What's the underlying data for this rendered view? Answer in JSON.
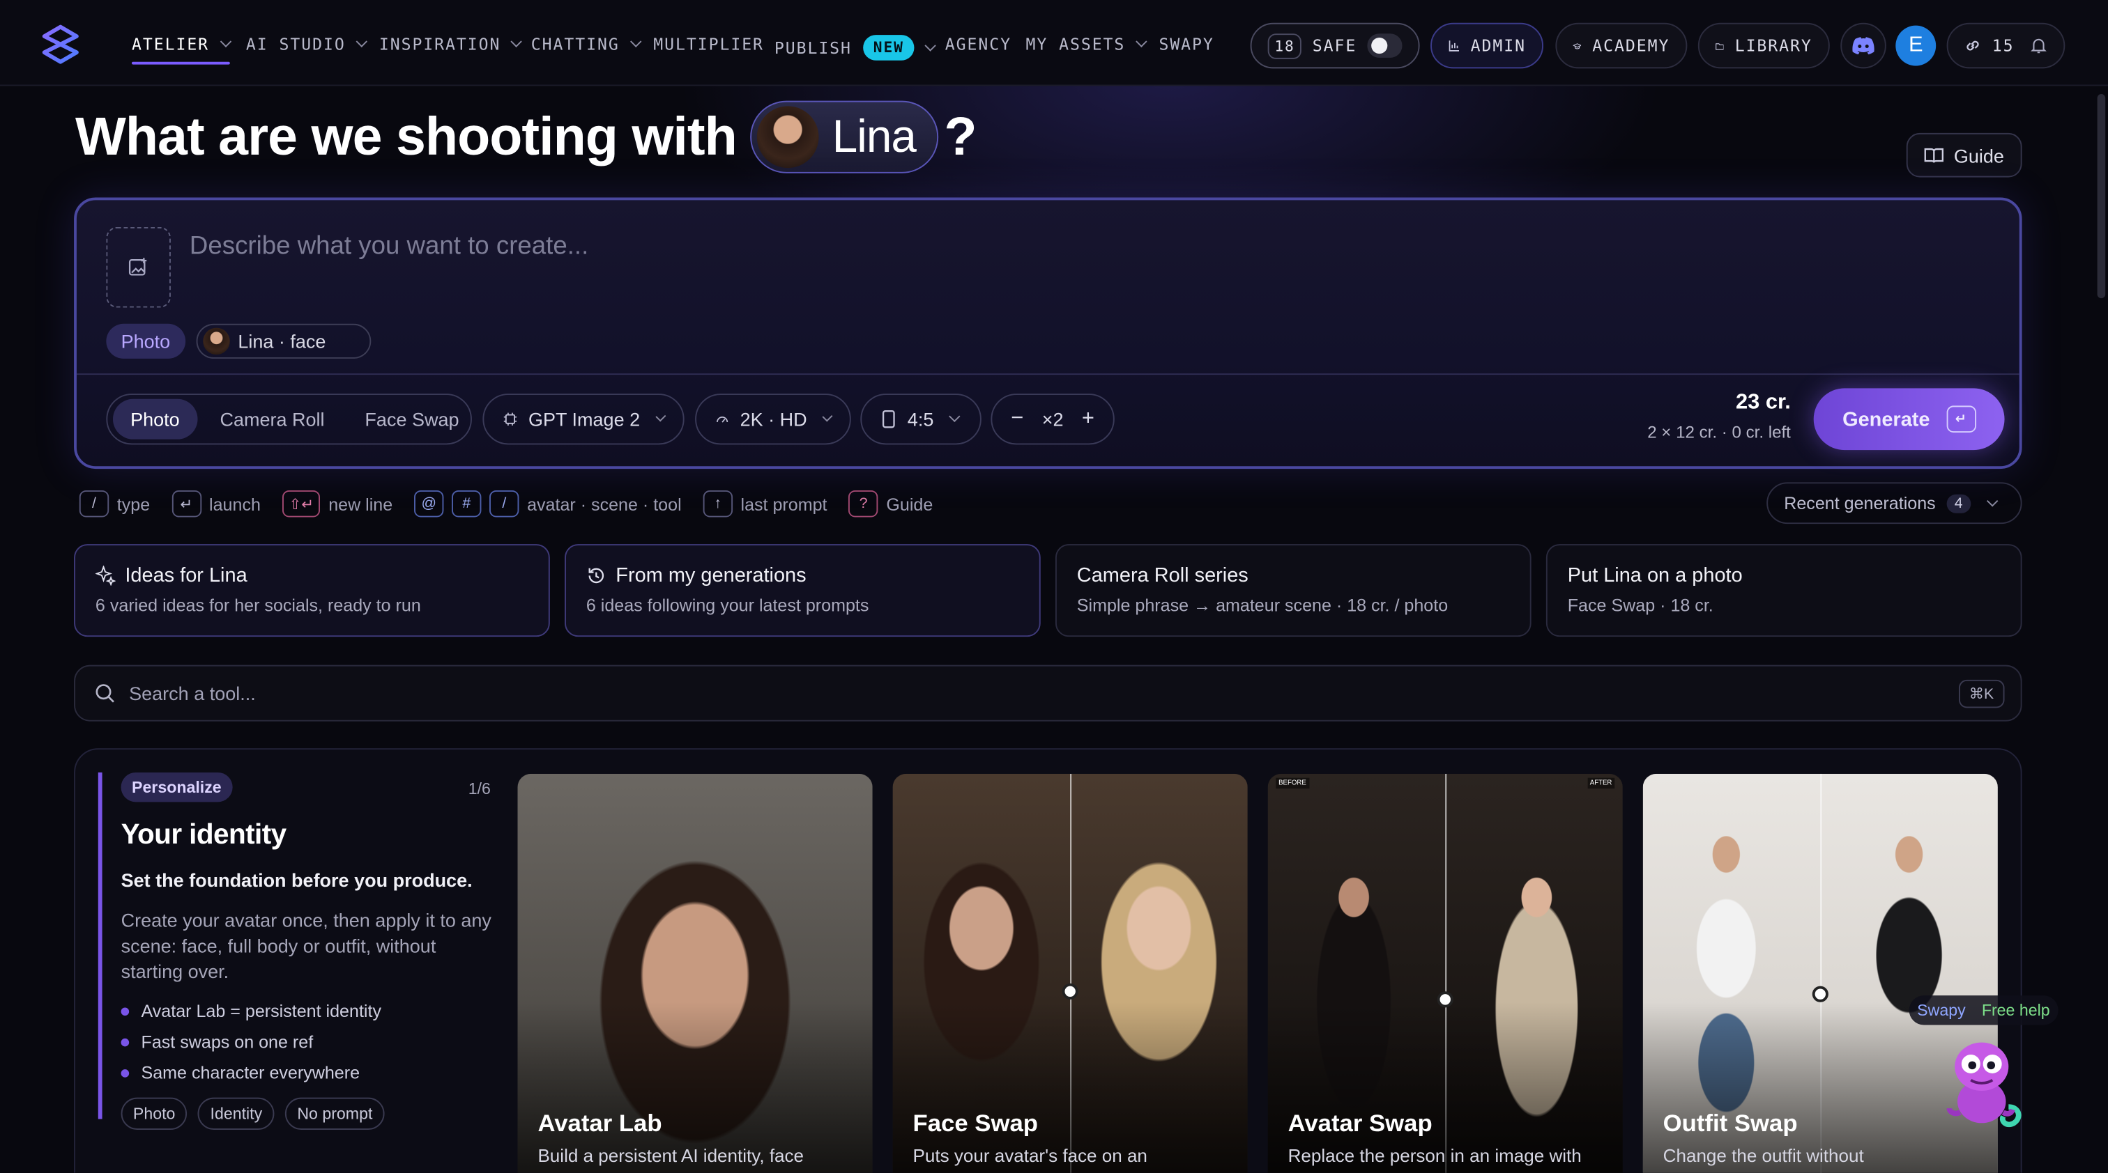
{
  "nav": {
    "items": [
      {
        "label": "ATELIER",
        "dropdown": true,
        "active": true
      },
      {
        "label": "AI STUDIO",
        "dropdown": true
      },
      {
        "label": "INSPIRATION",
        "dropdown": true
      },
      {
        "label": "CHATTING",
        "dropdown": true
      },
      {
        "label": "MULTIPLIER",
        "dropdown": false
      },
      {
        "label": "PUBLISH",
        "dropdown": true,
        "badge": "NEW"
      },
      {
        "label": "AGENCY",
        "dropdown": false
      },
      {
        "label": "MY ASSETS",
        "dropdown": true
      },
      {
        "label": "SWAPY",
        "dropdown": false
      }
    ],
    "safe_count": "18",
    "safe_label": "SAFE",
    "admin_label": "ADMIN",
    "academy_label": "ACADEMY",
    "library_label": "LIBRARY",
    "avatar_initial": "E",
    "credits": "15",
    "accent_color": "#7b5cff"
  },
  "heading": {
    "prefix": "What are we shooting with",
    "avatar_name": "Lina",
    "suffix": "?"
  },
  "guide_label": "Guide",
  "prompt": {
    "placeholder": "Describe what you want to create...",
    "tag_type": "Photo",
    "tag_avatar": "Lina · face",
    "modes": [
      "Photo",
      "Camera Roll",
      "Face Swap"
    ],
    "model": "GPT Image 2",
    "resolution": "2K · HD",
    "ratio": "4:5",
    "quantity": "×2",
    "cost": "23 cr.",
    "cost_detail": "2 × 12 cr. · 0 cr. left",
    "generate_label": "Generate"
  },
  "hints": [
    {
      "keys": [
        "/"
      ],
      "label": "type",
      "style": ""
    },
    {
      "keys": [
        "↵"
      ],
      "label": "launch",
      "style": ""
    },
    {
      "keys": [
        "⇧↵"
      ],
      "label": "new line",
      "style": "pink"
    },
    {
      "keys": [
        "@",
        "#",
        "/"
      ],
      "label": "avatar · scene · tool",
      "style": "blue"
    },
    {
      "keys": [
        "↑"
      ],
      "label": "last prompt",
      "style": ""
    },
    {
      "keys": [
        "?"
      ],
      "label": "Guide",
      "style": "pink"
    }
  ],
  "recent": {
    "label": "Recent generations",
    "count": "4"
  },
  "quick_cards": [
    {
      "title": "Ideas for Lina",
      "subtitle": "6 varied ideas for her socials, ready to run",
      "icon": "sparkles-icon"
    },
    {
      "title": "From my generations",
      "subtitle": "6 ideas following your latest prompts",
      "icon": "history-icon"
    },
    {
      "title": "Camera Roll series",
      "subtitle": "Simple phrase → amateur scene · 18 cr. / photo",
      "icon": ""
    },
    {
      "title": "Put Lina on a photo",
      "subtitle": "Face Swap · 18 cr.",
      "icon": ""
    }
  ],
  "search": {
    "placeholder": "Search a tool...",
    "shortcut": "⌘K"
  },
  "identity": {
    "chip": "Personalize",
    "counter": "1/6",
    "title": "Your identity",
    "lead": "Set the foundation before you produce.",
    "description": "Create your avatar once, then apply it to any scene: face, full body or outfit, without starting over.",
    "bullets": [
      "Avatar Lab = persistent identity",
      "Fast swaps on one ref",
      "Same character everywhere"
    ],
    "tags": [
      "Photo",
      "Identity",
      "No prompt"
    ]
  },
  "tools": [
    {
      "name": "Avatar Lab",
      "description": "Build a persistent AI identity, face",
      "split": false
    },
    {
      "name": "Face Swap",
      "description": "Puts your avatar's face on an",
      "split": true
    },
    {
      "name": "Avatar Swap",
      "description": "Replace the person in an image with",
      "split": true,
      "before_label": "BEFORE",
      "after_label": "AFTER"
    },
    {
      "name": "Outfit Swap",
      "description": "Change the outfit without",
      "split": true
    }
  ],
  "swapy": {
    "name": "Swapy",
    "help": "Free help"
  }
}
